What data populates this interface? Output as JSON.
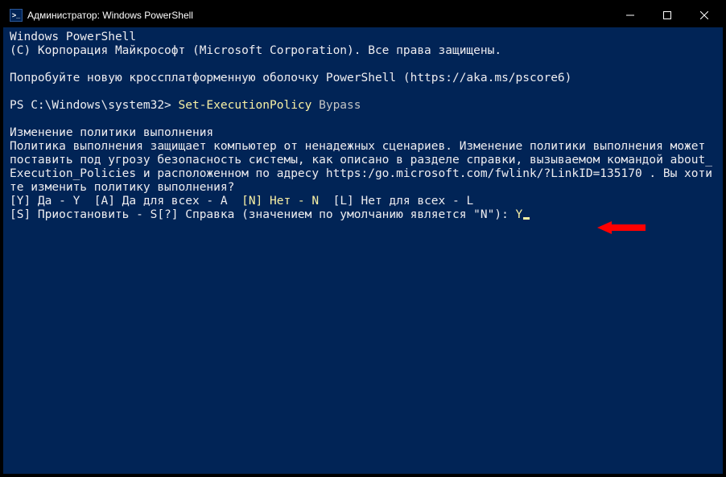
{
  "titlebar": {
    "title": "Администратор: Windows PowerShell"
  },
  "terminal": {
    "header1": "Windows PowerShell",
    "header2": "(C) Корпорация Майкрософт (Microsoft Corporation). Все права защищены.",
    "tryline": "Попробуйте новую кроссплатформенную оболочку PowerShell (https://aka.ms/pscore6)",
    "prompt": "PS C:\\Windows\\system32> ",
    "command": "Set-ExecutionPolicy",
    "argument": " Bypass",
    "policy_title": "Изменение политики выполнения",
    "policy_body": "Политика выполнения защищает компьютер от ненадежных сценариев. Изменение политики выполнения может поставить под угрозу безопасность системы, как описано в разделе справки, вызываемом командой about_Execution_Policies и расположенном по адресу https:/go.microsoft.com/fwlink/?LinkID=135170 . Вы хотите изменить политику выполнения?",
    "options_line1_pre": "[Y] Да - Y  [A] Да для всех - A  ",
    "options_line1_mid": "[N] Нет - N",
    "options_line1_post": "  [L] Нет для всех - L",
    "options_line2_pre": "[S] Приостановить - S[?] Справка (значением по умолчанию является \"N\"): ",
    "input": "Y"
  }
}
